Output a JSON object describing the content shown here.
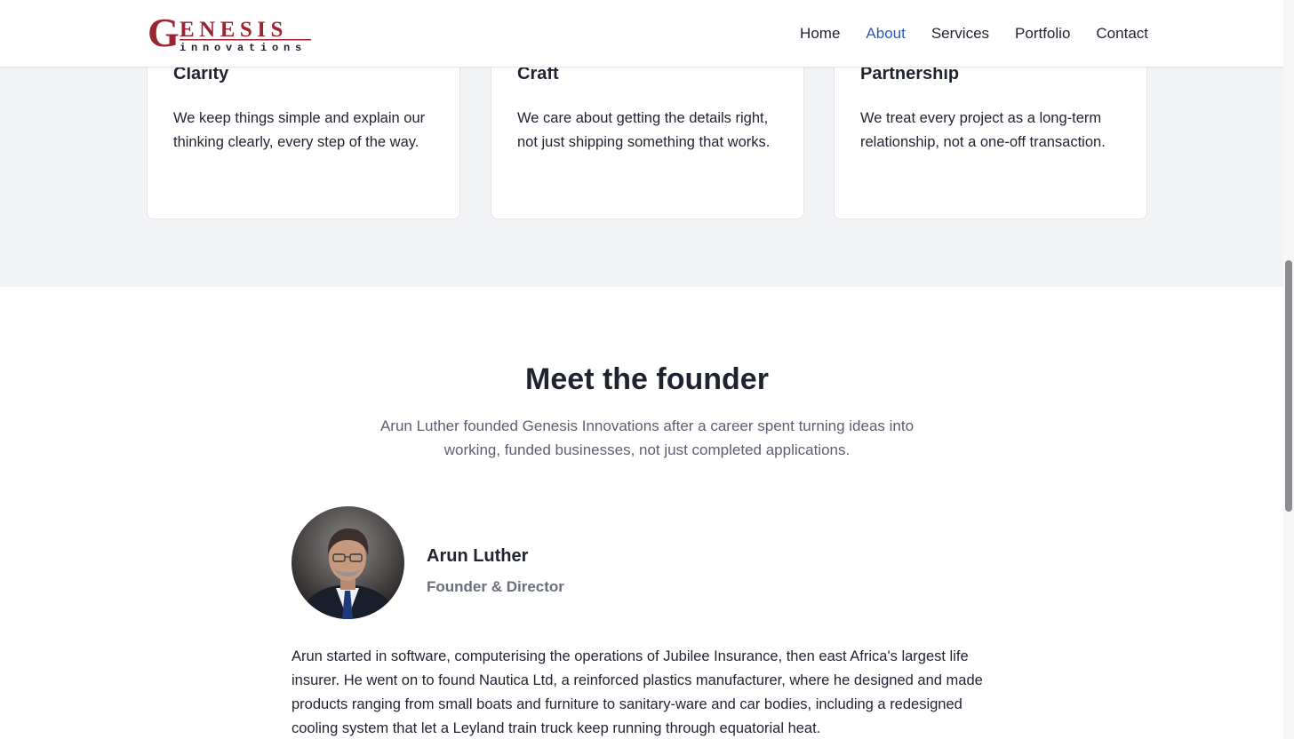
{
  "header": {
    "logo_text": "GENESIS",
    "logo_subtext": "innovations",
    "nav": [
      {
        "label": "Home"
      },
      {
        "label": "About"
      },
      {
        "label": "Services"
      },
      {
        "label": "Portfolio"
      },
      {
        "label": "Contact"
      }
    ],
    "active_nav": "About"
  },
  "values": [
    {
      "title": "Clarity",
      "text": "We keep things simple and explain our thinking clearly, every step of the way."
    },
    {
      "title": "Craft",
      "text": "We care about getting the details right, not just shipping something that works."
    },
    {
      "title": "Partnership",
      "text": "We treat every project as a long-term relationship, not a one-off transaction."
    }
  ],
  "founder": {
    "heading": "Meet the founder",
    "intro": "Arun Luther founded Genesis Innovations after a career spent turning ideas into working, funded businesses, not just completed applications.",
    "name": "Arun Luther",
    "role": "Founder & Director",
    "bio": "Arun started in software, computerising the operations of Jubilee Insurance, then east Africa's largest life insurer. He went on to found Nautica Ltd, a reinforced plastics manufacturer, where he designed and made products ranging from small boats and furniture to sanitary-ware and car bodies, including a redesigned cooling system that let a Leyland train truck keep running through equatorial heat."
  },
  "colors": {
    "brand_red": "#9b2530",
    "nav_active": "#2b5bb5",
    "text": "#1f2330",
    "muted": "#5b6070",
    "band_bg": "#f3f4f6"
  }
}
